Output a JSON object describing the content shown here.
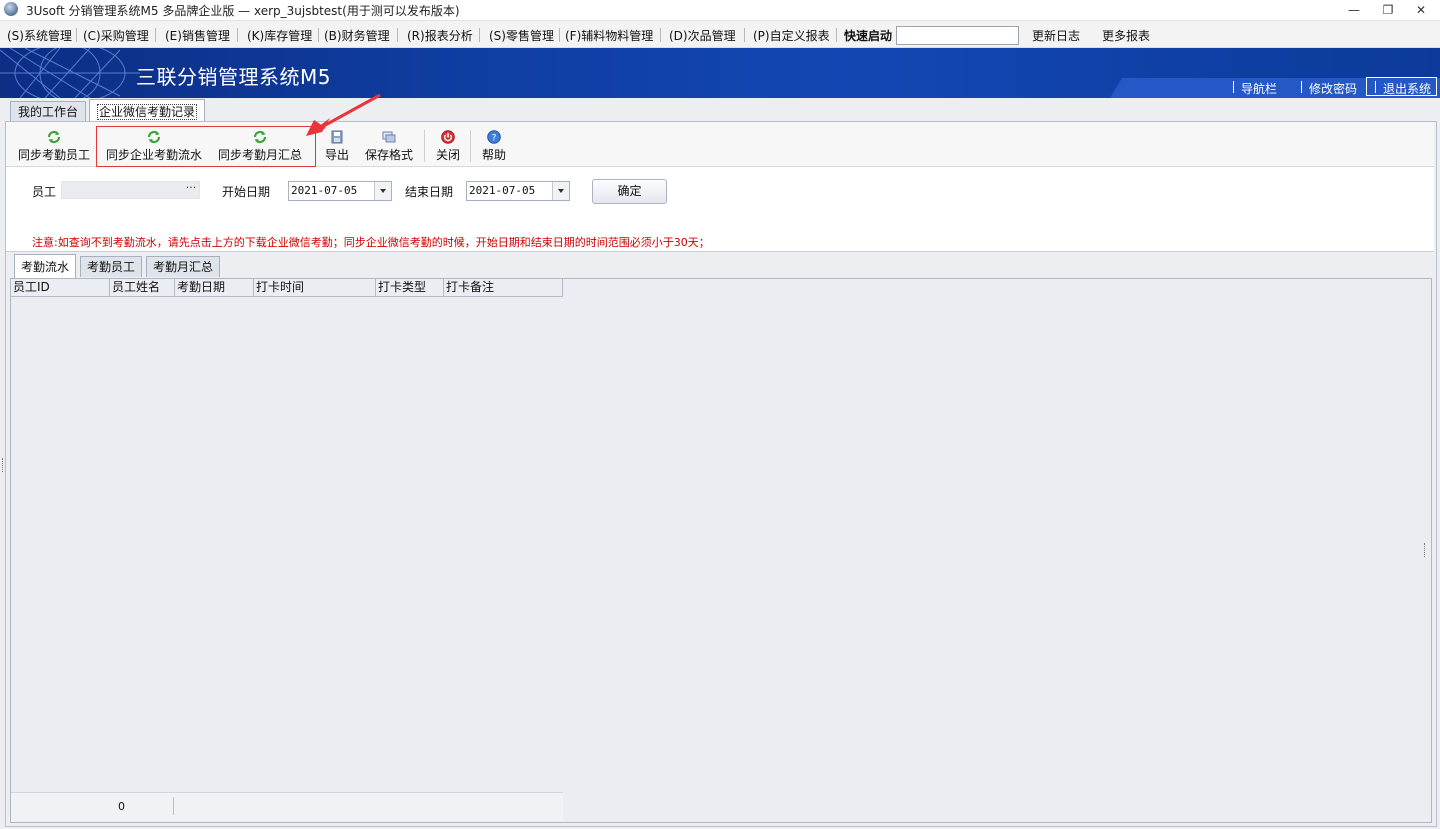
{
  "window": {
    "title": "3Usoft 分销管理系统M5 多品牌企业版 — xerp_3ujsbtest(用于测可以发布版本)",
    "minimize": "—",
    "restore": "❐",
    "close": "✕"
  },
  "menu": {
    "items": [
      "(S)系统管理",
      "(C)采购管理",
      "(E)销售管理",
      "(K)库存管理",
      "(B)财务管理",
      "(R)报表分析",
      "(S)零售管理",
      "(F)辅料物料管理",
      "(D)次品管理",
      "(P)自定义报表"
    ],
    "quick_start_label": "快速启动",
    "quick_start_value": "",
    "changelog": "更新日志",
    "more_reports": "更多报表"
  },
  "banner": {
    "brand": "三联分销管理系统M5",
    "nav_label": "导航栏",
    "change_password": "修改密码",
    "logout": "退出系统"
  },
  "top_tabs": [
    "我的工作台",
    "企业微信考勤记录"
  ],
  "toolbar": {
    "sync_employees": "同步考勤员工",
    "sync_flow": "同步企业考勤流水",
    "sync_monthly": "同步考勤月汇总",
    "export": "导出",
    "save_format": "保存格式",
    "close": "关闭",
    "help": "帮助"
  },
  "query": {
    "employee_label": "员工",
    "employee_value": "",
    "employee_picker": "···",
    "start_label": "开始日期",
    "start_value": "2021-07-05",
    "end_label": "结束日期",
    "end_value": "2021-07-05",
    "confirm": "确定",
    "notice": "注意:如查询不到考勤流水，请先点击上方的下载企业微信考勤；同步企业微信考勤的时候，开始日期和结束日期的时间范围必须小于30天；"
  },
  "grid_tabs": [
    "考勤流水",
    "考勤员工",
    "考勤月汇总"
  ],
  "grid": {
    "columns": [
      "员工ID",
      "员工姓名",
      "考勤日期",
      "打卡时间",
      "打卡类型",
      "打卡备注"
    ],
    "rows": [],
    "footer_count": "0"
  },
  "colors": {
    "banner": "#0f3c9f",
    "highlight": "#e4373d",
    "notice": "#d00000",
    "sync_icon": "#3aa33a",
    "close_icon": "#d9323a",
    "help_icon": "#3d7fd6"
  }
}
